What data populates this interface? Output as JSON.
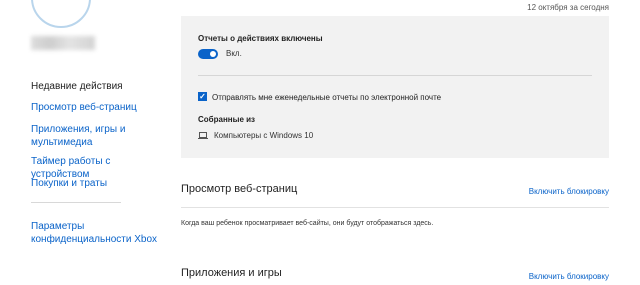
{
  "header": {
    "date": "12 октября за сегодня"
  },
  "sidebar": {
    "items": [
      {
        "label": "Недавние действия"
      },
      {
        "label": "Просмотр веб-страниц"
      },
      {
        "label": "Приложения, игры и\nмультимедиа"
      },
      {
        "label": "Таймер работы с устройством"
      },
      {
        "label": "Покупки и траты"
      },
      {
        "label": "Параметры\nконфиденциальности Xbox"
      }
    ]
  },
  "activity": {
    "reports_on_title": "Отчеты о действиях включены",
    "toggle_label": "Вкл.",
    "weekly_email_label": "Отправлять мне еженедельные отчеты по электронной почте",
    "collected_from_title": "Собранные из",
    "device_label": "Компьютеры с Windows 10"
  },
  "sections": [
    {
      "title": "Просмотр веб-страниц",
      "action_label": "Включить блокировку",
      "description": "Когда ваш ребенок просматривает веб-сайты, они будут отображаться здесь."
    },
    {
      "title": "Приложения и игры",
      "action_label": "Включить блокировку"
    }
  ],
  "colors": {
    "accent": "#0a63c9",
    "panel_bg": "#f2f2f2"
  }
}
